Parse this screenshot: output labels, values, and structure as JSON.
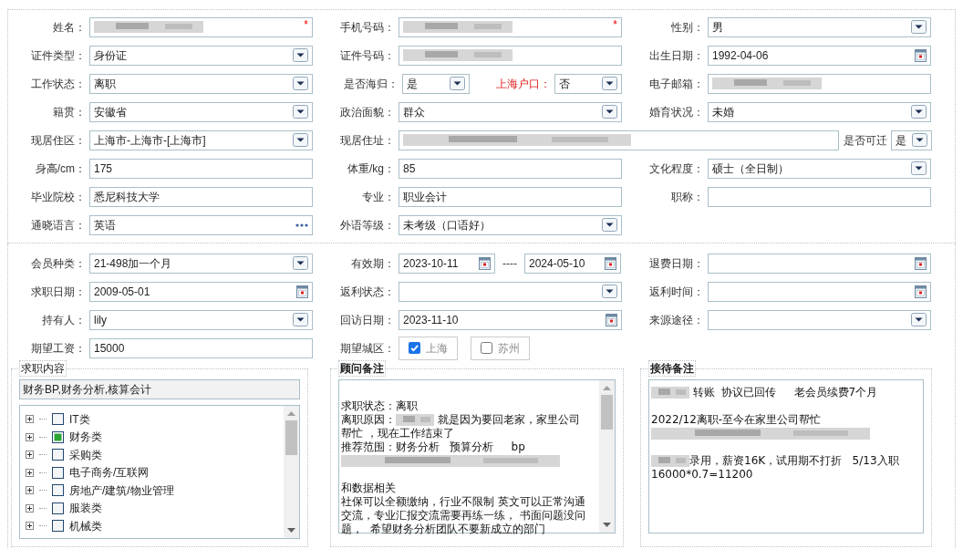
{
  "profile": {
    "rows": [
      [
        {
          "kind": "text",
          "label": "姓名：",
          "redacted": true,
          "required_mark": "*"
        },
        {
          "kind": "text",
          "label": "手机号码：",
          "redacted": true,
          "required_mark": "*"
        },
        {
          "kind": "select",
          "label": "性别：",
          "value": "男"
        }
      ],
      [
        {
          "kind": "select",
          "label": "证件类型：",
          "value": "身份证"
        },
        {
          "kind": "text",
          "label": "证件号码：",
          "redacted": true
        },
        {
          "kind": "date",
          "label": "出生日期：",
          "value": "1992-04-06"
        }
      ],
      [
        {
          "kind": "select",
          "label": "工作状态：",
          "value": "离职"
        },
        {
          "kind": "pair",
          "fields": [
            {
              "label": "是否海归：",
              "value": "是",
              "highlight": false
            },
            {
              "label": "上海户口：",
              "value": "否",
              "highlight": true
            }
          ]
        },
        {
          "kind": "text",
          "label": "电子邮箱：",
          "redacted": true
        }
      ],
      [
        {
          "kind": "select",
          "label": "籍贯：",
          "value": "安徽省"
        },
        {
          "kind": "select",
          "label": "政治面貌：",
          "value": "群众"
        },
        {
          "kind": "select",
          "label": "婚育状况：",
          "value": "未婚"
        }
      ],
      [
        {
          "kind": "select",
          "label": "现居住区：",
          "value": "上海市-上海市-[上海市]"
        },
        {
          "kind": "address",
          "label": "现居住址：",
          "redacted": true
        },
        {
          "kind": "mini-select",
          "label": "是否可迁",
          "value": "是"
        }
      ],
      [
        {
          "kind": "text",
          "label": "身高/cm：",
          "value": "175"
        },
        {
          "kind": "text",
          "label": "体重/kg：",
          "value": "85"
        },
        {
          "kind": "select",
          "label": "文化程度：",
          "value": "硕士（全日制）"
        }
      ],
      [
        {
          "kind": "text",
          "label": "毕业院校：",
          "value": "悉尼科技大学"
        },
        {
          "kind": "text",
          "label": "专业：",
          "value": "职业会计"
        },
        {
          "kind": "text",
          "label": "职称："
        }
      ],
      [
        {
          "kind": "lookup",
          "label": "通晓语言：",
          "value": "英语"
        },
        {
          "kind": "select",
          "label": "外语等级：",
          "value": "未考级（口语好）"
        }
      ]
    ]
  },
  "membership": {
    "rows": [
      [
        {
          "kind": "select",
          "label": "会员种类：",
          "value": "21-498加一个月"
        },
        {
          "kind": "date-range",
          "label": "有效期：",
          "value": "2023-10-11",
          "separator": "----",
          "value_to": "2024-05-10"
        },
        {
          "kind": "date",
          "label": "退费日期："
        }
      ],
      [
        {
          "kind": "date",
          "label": "求职日期：",
          "value": "2009-05-01"
        },
        {
          "kind": "select",
          "label": "返利状态："
        },
        {
          "kind": "date",
          "label": "返利时间："
        }
      ],
      [
        {
          "kind": "select",
          "label": "持有人：",
          "value": "lily"
        },
        {
          "kind": "date",
          "label": "回访日期：",
          "value": "2023-11-10"
        },
        {
          "kind": "select",
          "label": "来源途径："
        }
      ],
      [
        {
          "kind": "text",
          "label": "期望工资：",
          "value": "15000"
        },
        {
          "kind": "checkgroup",
          "label": "期望城区：",
          "options": [
            {
              "label": "上海",
              "checked": true
            },
            {
              "label": "苏州",
              "checked": false
            }
          ]
        }
      ]
    ]
  },
  "job_panel": {
    "title": "求职内容",
    "bold": false,
    "summary": "财务BP,财务分析,核算会计",
    "tree": [
      {
        "label": "IT类",
        "checked": false
      },
      {
        "label": "财务类",
        "checked": true
      },
      {
        "label": "采购类",
        "checked": false
      },
      {
        "label": "电子商务/互联网",
        "checked": false
      },
      {
        "label": "房地产/建筑/物业管理",
        "checked": false
      },
      {
        "label": "服装类",
        "checked": false
      },
      {
        "label": "机械类",
        "checked": false
      }
    ]
  },
  "notes_panels": [
    {
      "title": "顾问备注",
      "bold": true,
      "scrollbar": true,
      "lines": [
        {
          "kind": "spacer"
        },
        {
          "kind": "text",
          "segments": [
            {
              "kind": "text",
              "text": "求职状态：离职"
            }
          ]
        },
        {
          "kind": "text",
          "segments": [
            {
              "kind": "text",
              "text": "离职原因："
            },
            {
              "kind": "redacted"
            },
            {
              "kind": "text",
              "text": " 就是因为要回老家，家里公司"
            }
          ]
        },
        {
          "kind": "text",
          "segments": [
            {
              "kind": "text",
              "text": "帮忙 ，现在工作结束了"
            }
          ]
        },
        {
          "kind": "text",
          "segments": [
            {
              "kind": "text",
              "text": "推荐范围：财务分析   预算分析     bp"
            }
          ]
        },
        {
          "kind": "text",
          "segments": [
            {
              "kind": "redacted-line"
            }
          ]
        },
        {
          "kind": "spacer"
        },
        {
          "kind": "text",
          "segments": [
            {
              "kind": "text",
              "text": "和数据相关"
            }
          ]
        },
        {
          "kind": "text",
          "segments": [
            {
              "kind": "text",
              "text": "社保可以全额缴纳，行业不限制 英文可以正常沟通"
            }
          ]
        },
        {
          "kind": "text",
          "segments": [
            {
              "kind": "text",
              "text": "交流，专业汇报交流需要再练一练， 书面问题没问"
            }
          ]
        },
        {
          "kind": "text",
          "segments": [
            {
              "kind": "text",
              "text": "题，  希望财务分析团队不要新成立的部门"
            }
          ]
        }
      ]
    },
    {
      "title": "接待备注",
      "bold": true,
      "scrollbar": false,
      "lines": [
        {
          "kind": "text",
          "segments": [
            {
              "kind": "redacted"
            },
            {
              "kind": "text",
              "text": " 转账  协议已回传     老会员续费7个月"
            }
          ]
        },
        {
          "kind": "spacer"
        },
        {
          "kind": "text",
          "segments": [
            {
              "kind": "text",
              "text": "2022/12离职-至今在家里公司帮忙"
            }
          ]
        },
        {
          "kind": "text",
          "segments": [
            {
              "kind": "redacted-line"
            }
          ]
        },
        {
          "kind": "spacer"
        },
        {
          "kind": "text",
          "segments": [
            {
              "kind": "redacted"
            },
            {
              "kind": "text",
              "text": "录用，薪资16K，试用期不打折   5/13入职"
            }
          ]
        },
        {
          "kind": "text",
          "segments": [
            {
              "kind": "text",
              "text": "16000*0.7=11200"
            }
          ]
        }
      ]
    }
  ]
}
